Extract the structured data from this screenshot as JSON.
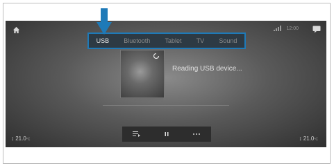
{
  "tabs": [
    {
      "label": "USB"
    },
    {
      "label": "Bluetooth"
    },
    {
      "label": "Tablet"
    },
    {
      "label": "TV"
    },
    {
      "label": "Sound"
    }
  ],
  "status": {
    "clock": "12:00"
  },
  "main": {
    "message": "Reading USB device..."
  },
  "climate": {
    "left_temp": "21.0",
    "right_temp": "21.0",
    "unit": "°C"
  },
  "colors": {
    "highlight": "#1e7ab8",
    "arrow": "#1e7ab8"
  },
  "icons": [
    "home-icon",
    "signal-icon",
    "chat-icon",
    "loading-icon",
    "playlist-icon",
    "pause-icon",
    "more-icon"
  ]
}
